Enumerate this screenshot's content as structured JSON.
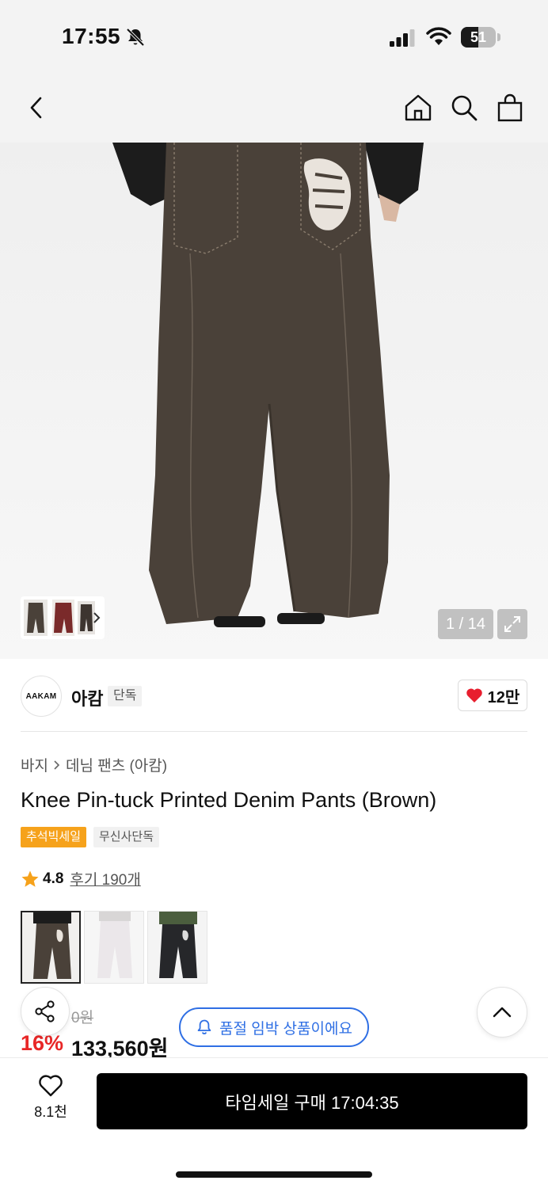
{
  "status_bar": {
    "time": "17:55",
    "battery_level": "51",
    "battery_fraction": 0.51
  },
  "header": {
    "icons": [
      "back-arrow-icon",
      "home-icon",
      "search-icon",
      "shopping-bag-icon"
    ]
  },
  "gallery": {
    "counter": "1 / 14",
    "icons": [
      "chevron-right-icon",
      "expand-icon"
    ]
  },
  "brand": {
    "logo_text": "AAKAM",
    "name": "아캄",
    "badge": "단독",
    "likes": "12만"
  },
  "breadcrumb": {
    "category": "바지",
    "subcategory": "데님 팬츠 (아캄)"
  },
  "product": {
    "title": "Knee Pin-tuck Printed Denim Pants (Brown)",
    "tags": [
      "추석빅세일",
      "무신사단독"
    ],
    "rating": "4.8",
    "reviews": "후기 190개",
    "color_options": [
      "Brown",
      "White",
      "Black"
    ],
    "original_price": "0원",
    "discount": "16%",
    "price": "133,560원"
  },
  "notice": {
    "soldout_text": "품절 임박 상품이에요"
  },
  "bottom_bar": {
    "wish_count": "8.1천",
    "buy_label": "타임세일 구매 17:04:35"
  },
  "colors": {
    "sale_tag": "#f6a21b",
    "discount": "#e82727",
    "notice": "#2f6fe4",
    "heart": "#e81e2e"
  }
}
